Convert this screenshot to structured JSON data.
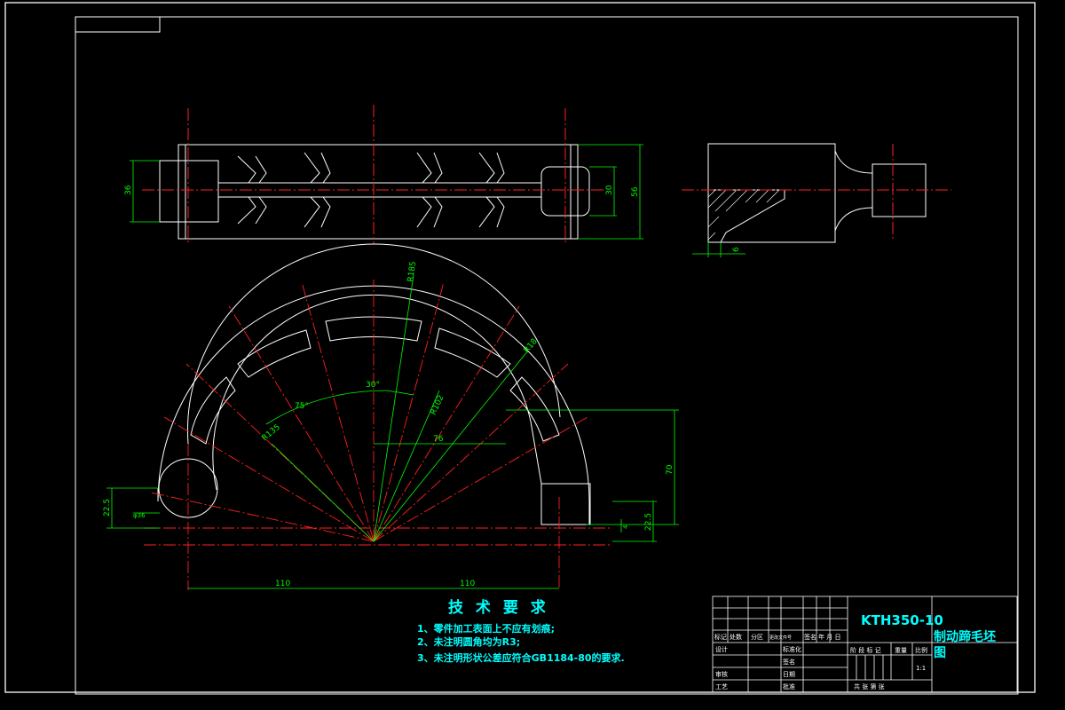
{
  "dimensions": {
    "top_left": "36",
    "top_inner": "30",
    "top_outer": "56",
    "side_small": "6",
    "r_outer": "R185",
    "r_inner": "R102",
    "r_fillet": "R18",
    "r_arc": "R135",
    "angle_a": "30°",
    "angle_b": "75°",
    "width_76": "76",
    "height_70": "70",
    "left_225": "22.5",
    "right_225": "22.5",
    "circle": "φ36",
    "small_4": "4",
    "span_left": "110",
    "span_right": "110"
  },
  "requirements": {
    "title": "技 术 要 求",
    "items": [
      "1、零件加工表面上不应有划痕;",
      "2、未注明圆角均为R3;",
      "3、未注明形状公差应符合GB1184-80的要求."
    ]
  },
  "title_block": {
    "code": "KTH350-10",
    "name_line1": "制动蹄毛坯",
    "name_line2": "图",
    "col_labels": [
      "标记",
      "处数",
      "分区",
      "更改文件号",
      "签名",
      "年 月 日"
    ],
    "row_design": "设计",
    "row_std": "标准化",
    "row_check": "审核",
    "row_proc": "工艺",
    "row_approve": "批准",
    "row_sign": "签名",
    "row_date": "日期",
    "stage_labels": [
      "阶 段 标 记",
      "重量",
      "比例"
    ],
    "scale": "1:1",
    "sheets": "共   张  第   张"
  }
}
